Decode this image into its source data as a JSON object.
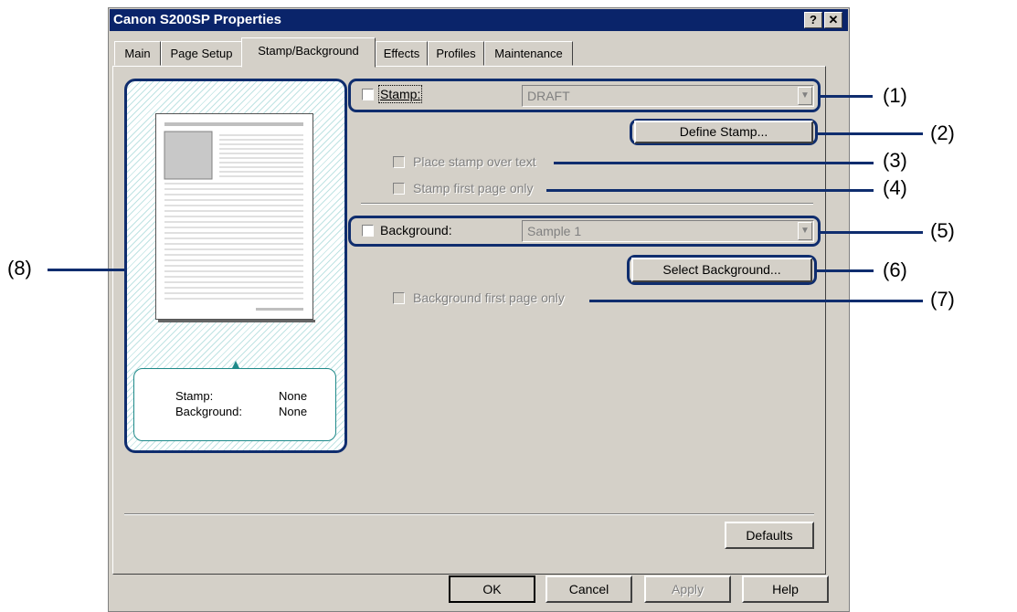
{
  "window": {
    "title": "Canon S200SP Properties",
    "help_button": "?",
    "close_button": "✕"
  },
  "tabs": [
    {
      "label": "Main"
    },
    {
      "label": "Page Setup"
    },
    {
      "label": "Stamp/Background",
      "active": true
    },
    {
      "label": "Effects"
    },
    {
      "label": "Profiles"
    },
    {
      "label": "Maintenance"
    }
  ],
  "stamp": {
    "label": "Stamp:",
    "checked": false,
    "combo_value": "DRAFT",
    "define_button": "Define Stamp...",
    "place_over_text": "Place stamp over text",
    "first_page_only": "Stamp first page only"
  },
  "background": {
    "label": "Background:",
    "checked": false,
    "combo_value": "Sample 1",
    "select_button": "Select Background...",
    "first_page_only": "Background first page only"
  },
  "preview": {
    "stamp_label": "Stamp:",
    "stamp_value": "None",
    "background_label": "Background:",
    "background_value": "None"
  },
  "buttons": {
    "defaults": "Defaults",
    "ok": "OK",
    "cancel": "Cancel",
    "apply": "Apply",
    "help": "Help"
  },
  "callouts": [
    "(1)",
    "(2)",
    "(3)",
    "(4)",
    "(5)",
    "(6)",
    "(7)",
    "(8)"
  ],
  "colors": {
    "titlebar": "#0a246a",
    "callout": "#0f2d6e",
    "dialog": "#d4d0c8",
    "preview_box_border": "#1f8a8a"
  }
}
